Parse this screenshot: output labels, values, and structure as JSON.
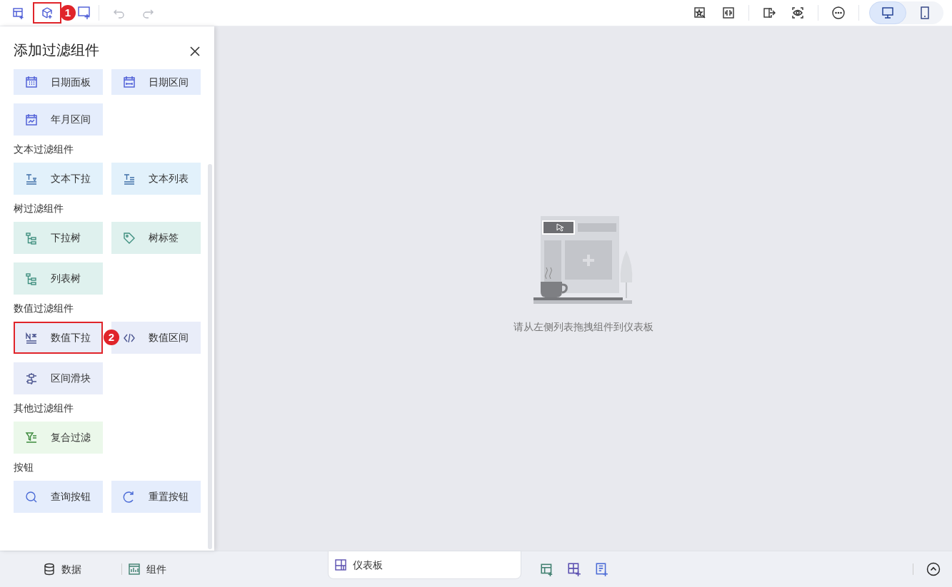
{
  "toolbar": {
    "left": [
      {
        "kind": "addchart",
        "highlighted": false,
        "disabled": false
      },
      {
        "kind": "addfilter",
        "highlighted": true,
        "callout": "1",
        "disabled": false
      },
      {
        "kind": "addtext",
        "highlighted": false,
        "disabled": false
      },
      {
        "kind": "undo",
        "highlighted": false,
        "disabled": true
      },
      {
        "kind": "redo",
        "highlighted": false,
        "disabled": true
      }
    ],
    "right": [
      {
        "kind": "wand"
      },
      {
        "kind": "fit"
      },
      {
        "kind": "divider"
      },
      {
        "kind": "exit"
      },
      {
        "kind": "preview"
      },
      {
        "kind": "divider"
      },
      {
        "kind": "more"
      }
    ],
    "devices": [
      {
        "kind": "desktop",
        "selected": true
      },
      {
        "kind": "mobile",
        "selected": false
      }
    ]
  },
  "panel": {
    "title": "添加过滤组件",
    "groups": [
      {
        "kind": "date",
        "tiles": [
          {
            "kind": "calendar",
            "label": "日期面板",
            "highlighted": false
          },
          {
            "kind": "daterange",
            "label": "日期区间",
            "highlighted": false
          },
          {
            "kind": "monthrange",
            "label": "年月区间",
            "highlighted": false
          }
        ]
      },
      {
        "kind": "text",
        "title": "文本过滤组件",
        "tiles": [
          {
            "kind": "textdropdown",
            "label": "文本下拉",
            "highlighted": false
          },
          {
            "kind": "textlist",
            "label": "文本列表",
            "highlighted": false
          }
        ]
      },
      {
        "kind": "tree",
        "title": "树过滤组件",
        "tiles": [
          {
            "kind": "treedropdown",
            "label": "下拉树",
            "highlighted": false
          },
          {
            "kind": "tag",
            "label": "树标签",
            "highlighted": false
          },
          {
            "kind": "treelist",
            "label": "列表树",
            "highlighted": false
          }
        ]
      },
      {
        "kind": "number",
        "title": "数值过滤组件",
        "tiles": [
          {
            "kind": "numberdropdown",
            "label": "数值下拉",
            "highlighted": true,
            "callout": "2"
          },
          {
            "kind": "code",
            "label": "数值区间",
            "highlighted": false
          },
          {
            "kind": "slider",
            "label": "区间滑块",
            "highlighted": false
          }
        ]
      },
      {
        "kind": "other",
        "title": "其他过滤组件",
        "tiles": [
          {
            "kind": "compound",
            "label": "复合过滤",
            "highlighted": false
          }
        ]
      },
      {
        "kind": "button",
        "title": "按钮",
        "tiles": [
          {
            "kind": "search",
            "label": "查询按钮",
            "highlighted": false
          },
          {
            "kind": "reset",
            "label": "重置按钮",
            "highlighted": false
          }
        ]
      }
    ]
  },
  "canvas": {
    "hint": "请从左侧列表拖拽组件到仪表板"
  },
  "bottom": {
    "tabs": [
      {
        "kind": "data",
        "label": "数据",
        "selected": false
      },
      {
        "kind": "widget",
        "label": "组件",
        "selected": false
      },
      {
        "kind": "dashboard",
        "label": "仪表板",
        "selected": true
      }
    ],
    "actions": [
      {
        "kind": "addchart"
      },
      {
        "kind": "addgrid"
      },
      {
        "kind": "addpage"
      }
    ]
  }
}
